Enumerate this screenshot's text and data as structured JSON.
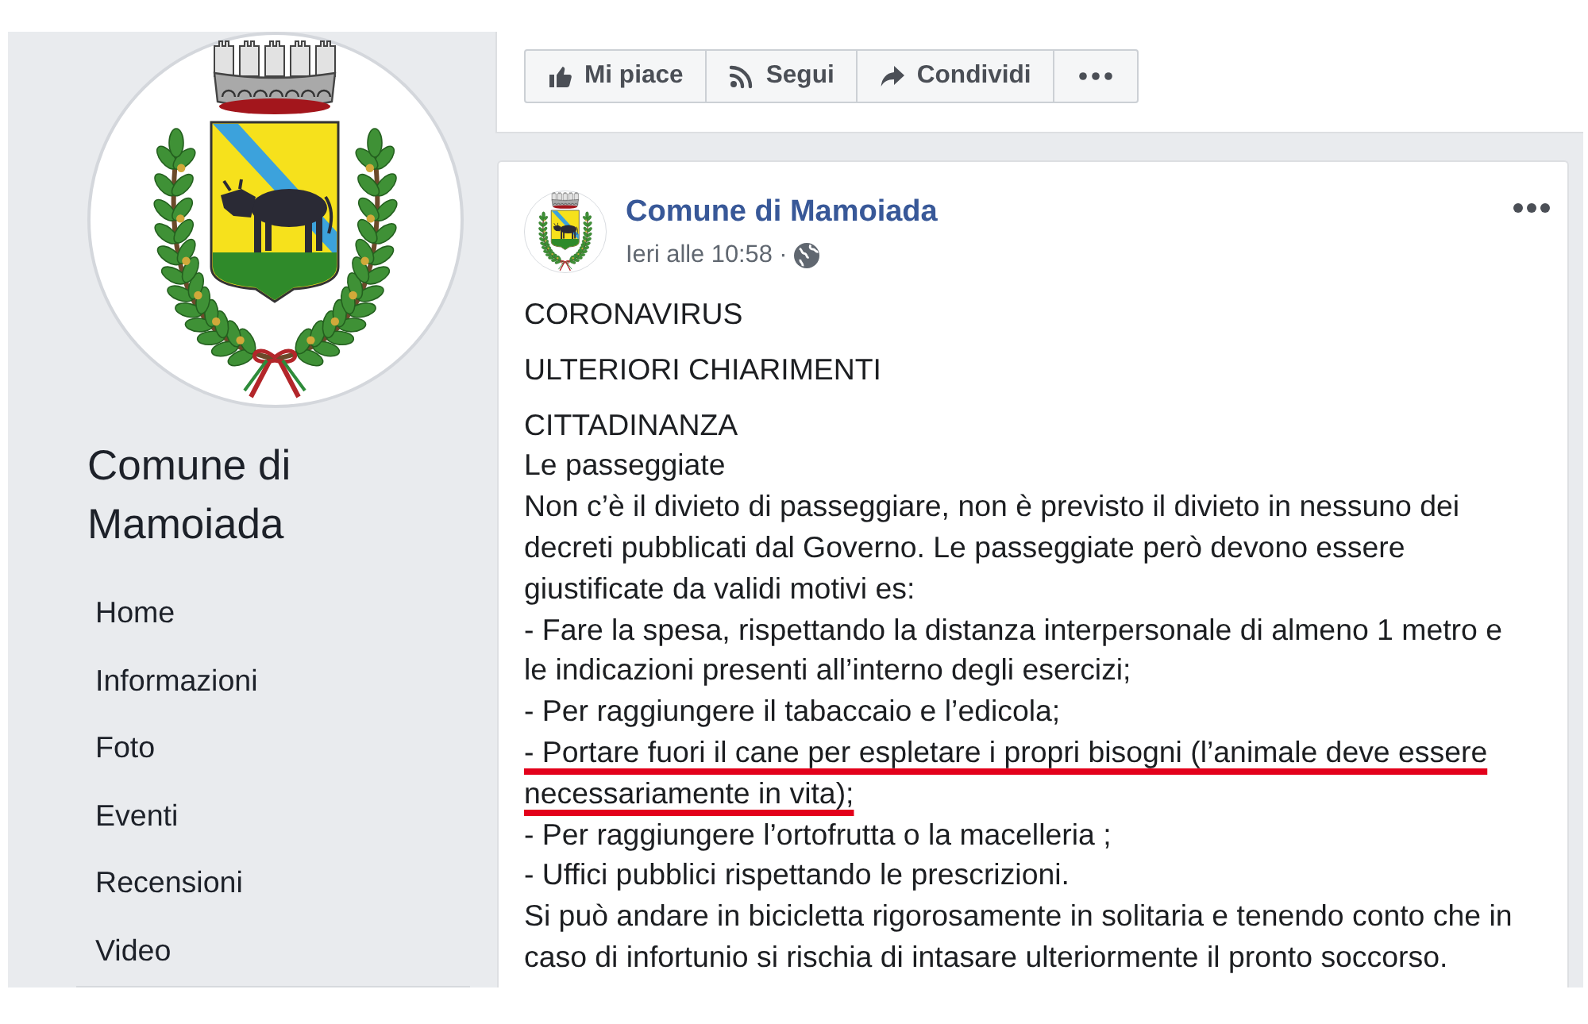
{
  "sidebar": {
    "page_name": "Comune di Mamoiada",
    "nav_items": [
      "Home",
      "Informazioni",
      "Foto",
      "Eventi",
      "Recensioni",
      "Video"
    ]
  },
  "page_actions": [
    {
      "kind": "like",
      "label": "Mi piace"
    },
    {
      "kind": "follow",
      "label": "Segui"
    },
    {
      "kind": "share",
      "label": "Condividi"
    },
    {
      "kind": "more"
    }
  ],
  "post": {
    "author": "Comune di Mamoiada",
    "timestamp": "Ieri alle 10:58 ·",
    "paragraphs": [
      {
        "lines": [
          {
            "text": "CORONAVIRUS",
            "underlined": false
          }
        ]
      },
      {
        "lines": [
          {
            "text": "ULTERIORI CHIARIMENTI",
            "underlined": false
          }
        ]
      },
      {
        "lines": [
          {
            "text": "CITTADINANZA",
            "underlined": false
          },
          {
            "text": "Le passeggiate",
            "underlined": false
          },
          {
            "text": "Non c’è il divieto di passeggiare, non è previsto il divieto in nessuno dei decreti pubblicati dal Governo. Le passeggiate però devono essere giustificate da validi motivi es:",
            "underlined": false
          },
          {
            "text": "- Fare la spesa, rispettando la distanza interpersonale di almeno 1 metro e le indicazioni presenti all’interno degli esercizi;",
            "underlined": false
          },
          {
            "text": "- Per raggiungere il tabaccaio e l’edicola;",
            "underlined": false
          },
          {
            "text": "- Portare fuori il cane per espletare i propri bisogni (l’animale deve essere necessariamente in vita);",
            "underlined": true
          },
          {
            "text": "- Per raggiungere l’ortofrutta o la macelleria ;",
            "underlined": false
          },
          {
            "text": "- Uffici pubblici rispettando le prescrizioni.",
            "underlined": false
          },
          {
            "text": "Si può andare in bicicletta rigorosamente in solitaria e tenendo conto che in caso di infortunio si rischia di intasare ulteriormente il pronto soccorso.",
            "underlined": false
          }
        ]
      }
    ]
  }
}
